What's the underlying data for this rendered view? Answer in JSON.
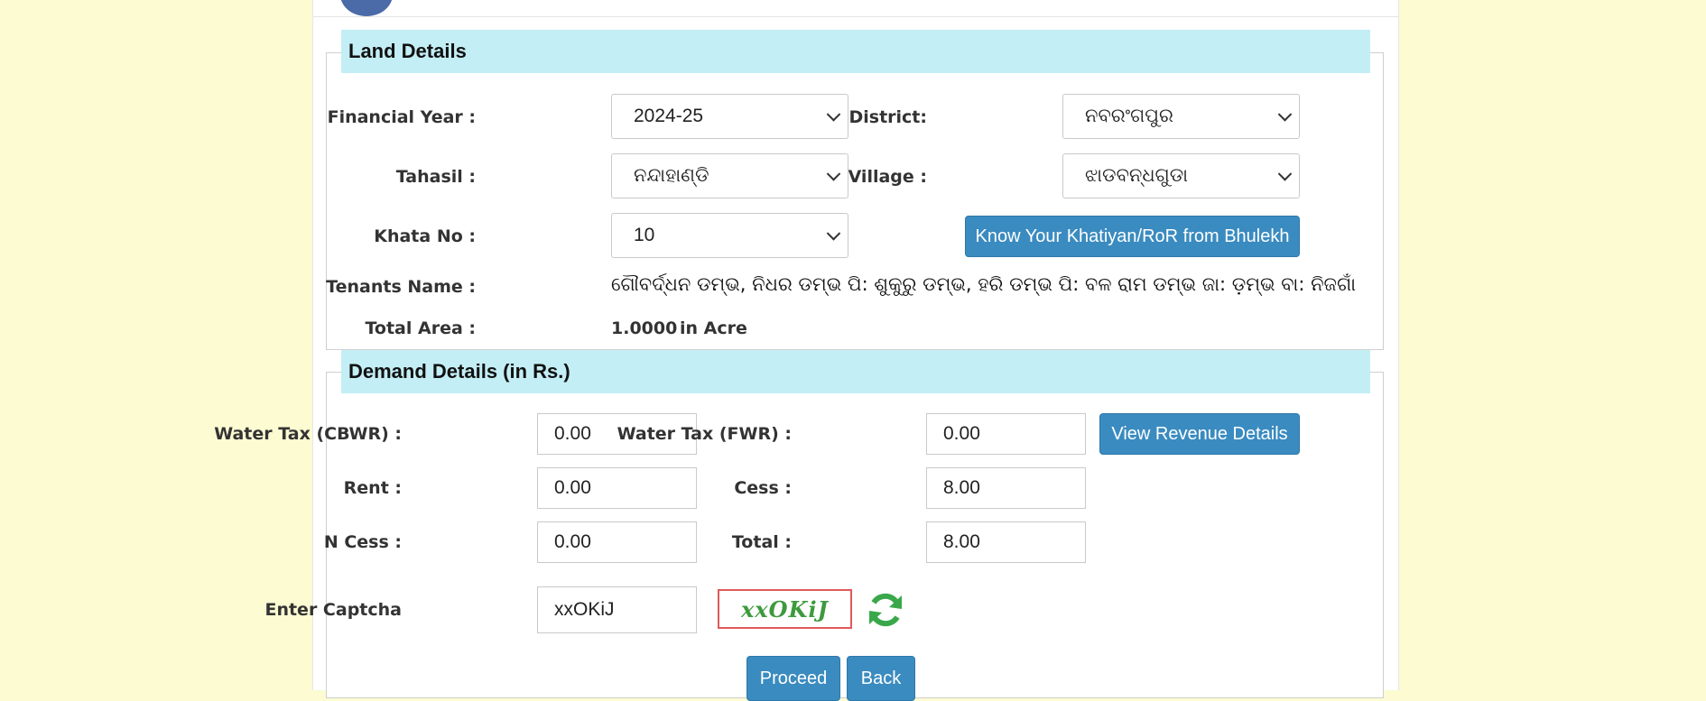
{
  "land_details": {
    "legend": "Land Details",
    "financial_year": {
      "label": "Financial Year :",
      "value": "2024-25"
    },
    "district": {
      "label": "District:",
      "value": "ନବରଂଗପୁର"
    },
    "tahasil": {
      "label": "Tahasil :",
      "value": "ନନ୍ଦାହାଣ୍ଡି"
    },
    "village": {
      "label": "Village :",
      "value": "ଝାଡବନ୍ଧଗୁଡା"
    },
    "khata_no": {
      "label": "Khata No :",
      "value": "10"
    },
    "bhulekh_button": "Know Your Khatiyan/RoR from Bhulekh",
    "tenants": {
      "label": "Tenants Name :",
      "value": "ଗୌବର୍ଦ୍ଧନ ଡମ୍ଭ, ନିଧର ଡମ୍ଭ ପି: ଶୁକୁରୁ ଡମ୍ଭ, ହରି ଡମ୍ଭ ପି: ବଳ ରାମ ଡମ୍ଭ ଜା: ଡ଼ମ୍ଭ ବା: ନିଜଗାଁ"
    },
    "total_area": {
      "label": "Total Area :",
      "value": "1.0000",
      "unit": "in Acre"
    }
  },
  "demand_details": {
    "legend": "Demand Details (in Rs.)",
    "water_tax_cbwr": {
      "label": "Water Tax (CBWR) :",
      "value": "0.00"
    },
    "water_tax_fwr": {
      "label": "Water Tax (FWR) :",
      "value": "0.00"
    },
    "view_revenue_button": "View Revenue Details",
    "rent": {
      "label": "Rent :",
      "value": "0.00"
    },
    "cess": {
      "label": "Cess :",
      "value": "8.00"
    },
    "n_cess": {
      "label": "N Cess :",
      "value": "0.00"
    },
    "total": {
      "label": "Total :",
      "value": "8.00"
    },
    "captcha": {
      "label": "Enter Captcha",
      "value": "xxOKiJ",
      "image_text": "xxOKiJ"
    }
  },
  "actions": {
    "proceed": "Proceed",
    "back": "Back"
  },
  "colors": {
    "legend_bg": "#c3eef5",
    "button": "#3a8bc0",
    "page_bg": "#fdfbd2",
    "captcha_text": "#3d9a3d",
    "refresh_icon": "#3aa84a"
  }
}
